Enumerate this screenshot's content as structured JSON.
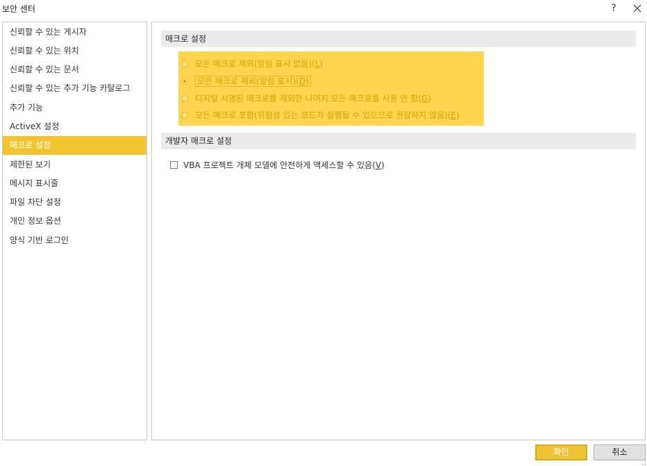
{
  "window": {
    "title": "보안 센터",
    "help_label": "?",
    "close_icon": "close-icon"
  },
  "sidebar": {
    "items": [
      {
        "label": "신뢰할 수 있는 게시자"
      },
      {
        "label": "신뢰할 수 있는 위치"
      },
      {
        "label": "신뢰할 수 있는 문서"
      },
      {
        "label": "신뢰할 수 있는 추가 기능 카탈로그"
      },
      {
        "label": "추가 기능"
      },
      {
        "label": "ActiveX 설정"
      },
      {
        "label": "매크로 설정",
        "selected": true
      },
      {
        "label": "제한된 보기"
      },
      {
        "label": "메시지 표시줄"
      },
      {
        "label": "파일 차단 설정"
      },
      {
        "label": "개인 정보 옵션"
      },
      {
        "label": "양식 기반 로그인"
      }
    ]
  },
  "macro_settings": {
    "header": "매크로 설정",
    "options": [
      {
        "text": "모든 매크로 제외(알림 표시 없음)",
        "key": "L",
        "checked": false
      },
      {
        "text": "모든 매크로 제외(알림 표시)",
        "key": "D",
        "checked": true
      },
      {
        "text": "디지털 서명된 매크로를 제외한 나머지 모든 매크로를 사용 안 함",
        "key": "G",
        "checked": false
      },
      {
        "text": "모든 매크로 포함(위험성 있는 코드가 실행될 수 있으므로 권장하지 않음)",
        "key": "E",
        "checked": false
      }
    ]
  },
  "developer_settings": {
    "header": "개발자 매크로 설정",
    "checkbox_text": "VBA 프로젝트 개체 모델에 안전하게 액세스할 수 있음",
    "checkbox_key": "V",
    "checked": false
  },
  "buttons": {
    "ok": "확인",
    "cancel": "취소"
  },
  "colors": {
    "accent": "#f2c431",
    "highlight": "#ffd44f",
    "section_bg": "#ebebeb"
  }
}
